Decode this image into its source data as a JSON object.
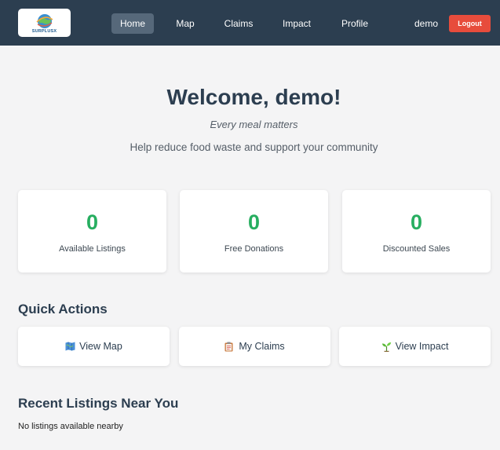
{
  "brand": {
    "logo_text": "SURPLUSX"
  },
  "nav": {
    "items": [
      {
        "label": "Home",
        "active": true
      },
      {
        "label": "Map",
        "active": false
      },
      {
        "label": "Claims",
        "active": false
      },
      {
        "label": "Impact",
        "active": false
      },
      {
        "label": "Profile",
        "active": false
      }
    ],
    "username": "demo",
    "logout_label": "Logout"
  },
  "hero": {
    "title": "Welcome, demo!",
    "tagline": "Every meal matters",
    "subtitle": "Help reduce food waste and support your community"
  },
  "stats": [
    {
      "value": "0",
      "label": "Available Listings"
    },
    {
      "value": "0",
      "label": "Free Donations"
    },
    {
      "value": "0",
      "label": "Discounted Sales"
    }
  ],
  "quick_actions": {
    "title": "Quick Actions",
    "items": [
      {
        "label": "View Map",
        "icon": "map-icon"
      },
      {
        "label": "My Claims",
        "icon": "clipboard-icon"
      },
      {
        "label": "View Impact",
        "icon": "seedling-icon"
      }
    ]
  },
  "recent": {
    "title": "Recent Listings Near You",
    "empty_text": "No listings available nearby"
  },
  "colors": {
    "navbar": "#2c3e50",
    "accent_green": "#27ae60",
    "logout_red": "#e74c3c",
    "background": "#f4f4f5"
  }
}
